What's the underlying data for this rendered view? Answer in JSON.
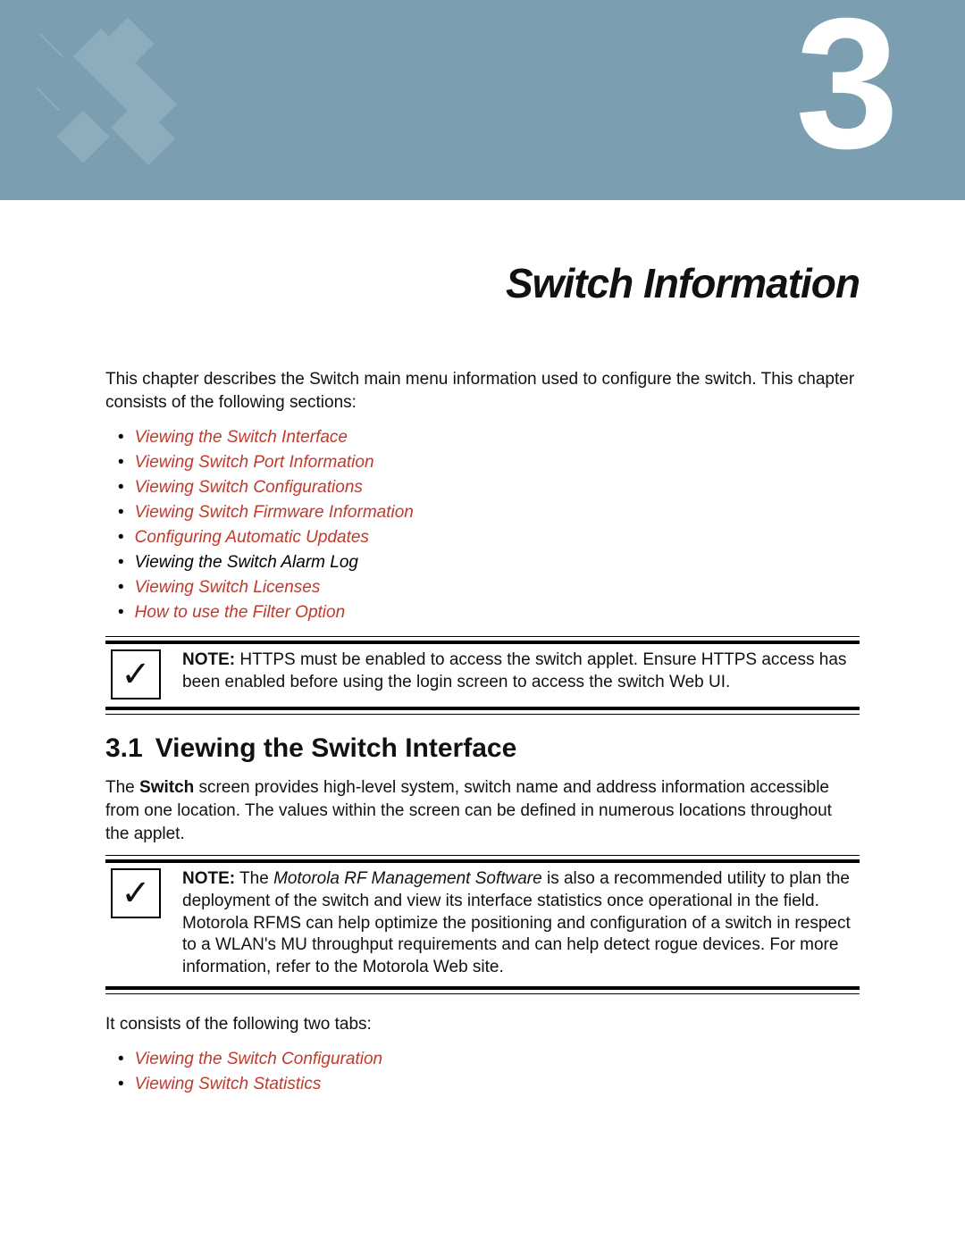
{
  "chapter_number": "3",
  "chapter_title": "Switch Information",
  "intro": "This chapter describes the Switch main menu information used to configure the switch. This chapter consists of the following sections:",
  "toc": [
    {
      "label": "Viewing the Switch Interface",
      "link": true
    },
    {
      "label": "Viewing Switch Port Information",
      "link": true
    },
    {
      "label": "Viewing Switch Configurations",
      "link": true
    },
    {
      "label": "Viewing Switch Firmware Information",
      "link": true
    },
    {
      "label": "Configuring Automatic Updates",
      "link": true
    },
    {
      "label": "Viewing the Switch Alarm Log",
      "link": false
    },
    {
      "label": "Viewing Switch Licenses",
      "link": true
    },
    {
      "label": "How to use the Filter Option",
      "link": true
    }
  ],
  "note1": {
    "label": "NOTE:",
    "text": " HTTPS must be enabled to access the switch applet. Ensure HTTPS access has been enabled before using the login screen to access the switch Web UI."
  },
  "section": {
    "num": "3.1",
    "title": "Viewing the Switch Interface",
    "body_pre": "The ",
    "body_bold": "Switch",
    "body_post": " screen provides high-level system, switch name and address information accessible from one location. The values within the screen can be defined in numerous locations throughout the applet."
  },
  "note2": {
    "label": "NOTE:",
    "pre": " The ",
    "italic": "Motorola RF Management Software",
    "post": " is also a recommended utility to plan the deployment of the switch and view its interface statistics once operational in the field. Motorola RFMS can help optimize the positioning and configuration of a switch in respect to a WLAN's MU throughput requirements and can help detect rogue devices. For more information, refer to the Motorola Web site."
  },
  "tabs_intro": "It consists of the following two tabs:",
  "tabs": [
    {
      "label": "Viewing the Switch Configuration",
      "link": true
    },
    {
      "label": "Viewing Switch Statistics",
      "link": true
    }
  ]
}
